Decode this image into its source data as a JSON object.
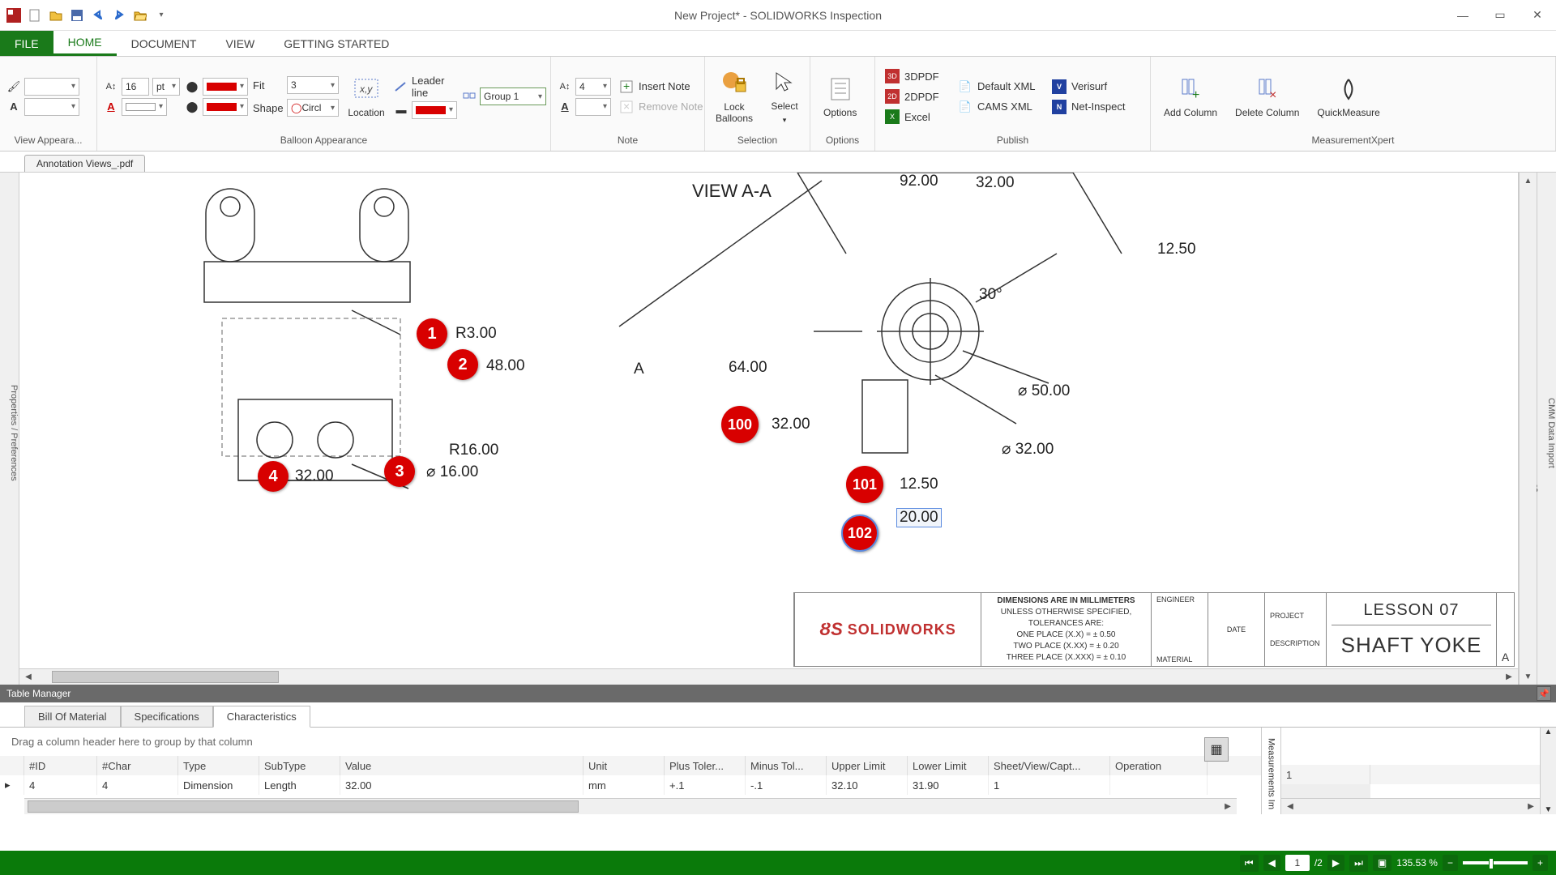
{
  "title": "New Project* - SOLIDWORKS Inspection",
  "menu": {
    "file": "FILE",
    "home": "HOME",
    "document": "DOCUMENT",
    "view": "VIEW",
    "getting_started": "GETTING STARTED"
  },
  "ribbon": {
    "view_appearance": "View Appeara...",
    "balloon": {
      "label": "Balloon Appearance",
      "font_size": "16",
      "font_unit": "pt",
      "shape": "Shape",
      "shape_val": "Circl",
      "fit": "Fit",
      "fit_val": "3",
      "location": "Location",
      "leader": "Leader line",
      "group": "Group 1"
    },
    "note": {
      "label": "Note",
      "font_val": "4",
      "insert": "Insert Note",
      "remove": "Remove Note"
    },
    "selection": {
      "label": "Selection",
      "lock": "Lock Balloons",
      "select": "Select"
    },
    "options": {
      "label": "Options",
      "btn": "Options"
    },
    "publish": {
      "label": "Publish",
      "threeD": "3DPDF",
      "twoD": "2DPDF",
      "excel": "Excel",
      "defxml": "Default XML",
      "cams": "CAMS XML",
      "verisurf": "Verisurf",
      "net": "Net-Inspect"
    },
    "measure": {
      "label": "MeasurementXpert",
      "add": "Add Column",
      "del": "Delete Column",
      "quick": "QuickMeasure"
    }
  },
  "doc_tab": "Annotation Views_.pdf",
  "drawing": {
    "view_label": "VIEW A-A",
    "dims": {
      "r300": "R3.00",
      "d4800": "48.00",
      "r1600": "R16.00",
      "dia16": "⌀ 16.00",
      "d3200": "32.00",
      "d9200": "92.00",
      "top3200": "32.00",
      "d1250r": "12.50",
      "ang30": "30°",
      "d6400": "64.00",
      "mid3200": "32.00",
      "dia50": "⌀ 50.00",
      "dia32": "⌀ 32.00",
      "d1250b": "12.50",
      "d2000": "20.00",
      "A": "A"
    },
    "balloons": {
      "b1": "1",
      "b2": "2",
      "b3": "3",
      "b4": "4",
      "b100": "100",
      "b101": "101",
      "b102": "102"
    },
    "title_block": {
      "logo": "SOLIDWORKS",
      "dim_note": "DIMENSIONS ARE IN  MILLIMETERS",
      "tol1": "UNLESS OTHERWISE SPECIFIED,",
      "tol2": "TOLERANCES ARE:",
      "tol3": "ONE PLACE (X.X) = ± 0.50",
      "tol4": "TWO PLACE (X.XX) = ± 0.20",
      "tol5": "THREE PLACE (X.XXX) = ± 0.10",
      "engineer": "ENGINEER",
      "date": "DATE",
      "project": "PROJECT",
      "lesson": "LESSON 07",
      "desc": "DESCRIPTION",
      "name": "SHAFT YOKE",
      "material": "MATERIAL",
      "A": "A"
    }
  },
  "side_left": "Properties / Preferences",
  "side_right_top": "CMM Data Import",
  "side_right_b": "B",
  "table_manager": {
    "title": "Table Manager",
    "tabs": {
      "bom": "Bill Of Material",
      "spec": "Specifications",
      "char": "Characteristics"
    },
    "hint": "Drag a column header here to group by that column",
    "headers": {
      "id": "#ID",
      "char": "#Char",
      "type": "Type",
      "subtype": "SubType",
      "value": "Value",
      "unit": "Unit",
      "plus": "Plus Toler...",
      "minus": "Minus Tol...",
      "upper": "Upper Limit",
      "lower": "Lower Limit",
      "sheet": "Sheet/View/Capt...",
      "operation": "Operation"
    },
    "row": {
      "id": "4",
      "char": "4",
      "type": "Dimension",
      "subtype": "Length",
      "value": "32.00",
      "unit": "mm",
      "plus": "+.1",
      "minus": "-.1",
      "upper": "32.10",
      "lower": "31.90",
      "sheet": "1",
      "operation": ""
    },
    "side_label": "Measurements Im",
    "side_val": "1"
  },
  "status": {
    "page": "1",
    "pages": "/2",
    "zoom": "135.53 %"
  }
}
